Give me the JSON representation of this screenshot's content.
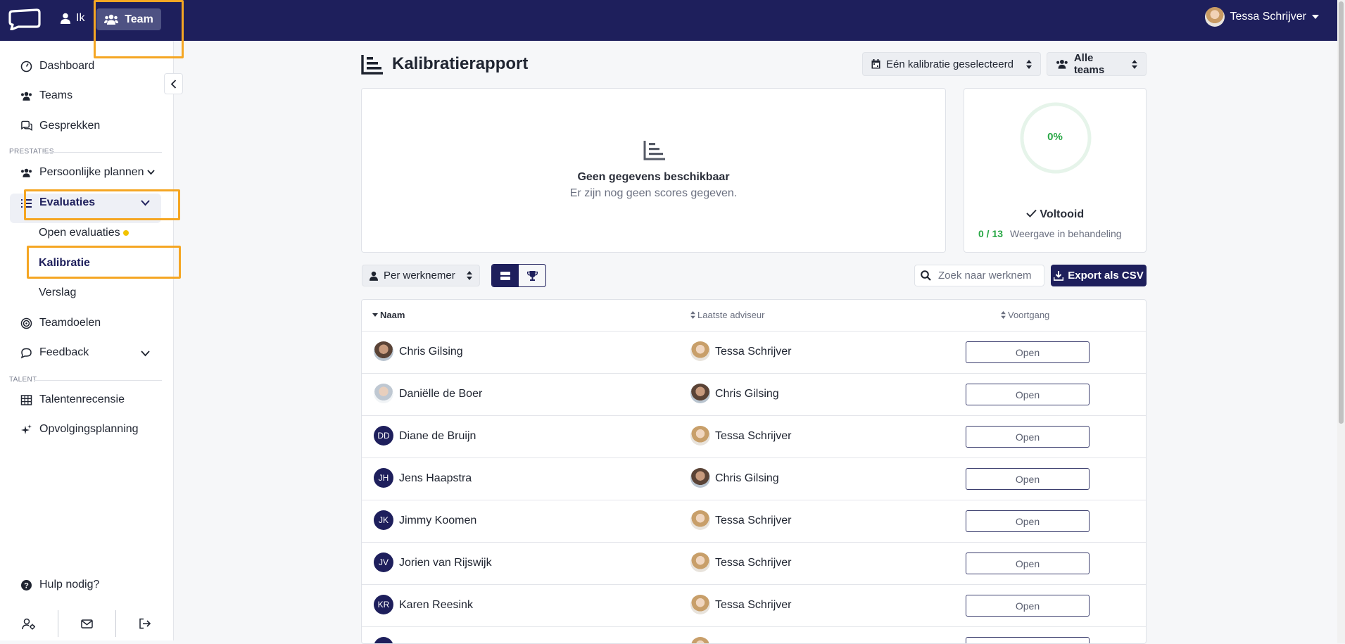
{
  "topbar": {
    "nav_ik": "Ik",
    "nav_team": "Team",
    "user_name": "Tessa Schrijver"
  },
  "sidebar": {
    "dashboard": "Dashboard",
    "teams": "Teams",
    "gesprekken": "Gesprekken",
    "section_prestaties": "PRESTATIES",
    "persoonlijke_plannen": "Persoonlijke plannen",
    "evaluaties": "Evaluaties",
    "open_evaluaties": "Open evaluaties",
    "kalibratie": "Kalibratie",
    "verslag": "Verslag",
    "teamdoelen": "Teamdoelen",
    "feedback": "Feedback",
    "section_talent": "TALENT",
    "talentenrecensie": "Talentenrecensie",
    "opvolgingsplanning": "Opvolgingsplanning",
    "help": "Hulp nodig?"
  },
  "header": {
    "title": "Kalibratierapport",
    "calibration_select": "Eén kalibratie geselecteerd",
    "teams_select": "Alle teams"
  },
  "empty_state": {
    "title": "Geen gegevens beschikbaar",
    "subtitle": "Er zijn nog geen scores gegeven."
  },
  "progress": {
    "percent_label": "0%",
    "percent_value": 0,
    "status": "Voltooid",
    "count": "0 / 13",
    "label": "Weergave in behandeling"
  },
  "toolbar": {
    "per_select": "Per werknemer",
    "search_placeholder": "Zoek naar werknem",
    "export": "Export als CSV"
  },
  "table": {
    "columns": {
      "name": "Naam",
      "advisor": "Laatste adviseur",
      "progress": "Voortgang"
    },
    "rows": [
      {
        "name": "Chris Gilsing",
        "initials": "",
        "advisor": "Tessa Schrijver",
        "status": "Open"
      },
      {
        "name": "Daniëlle de Boer",
        "initials": "",
        "advisor": "Chris Gilsing",
        "status": "Open"
      },
      {
        "name": "Diane de Bruijn",
        "initials": "DD",
        "advisor": "Tessa Schrijver",
        "status": "Open"
      },
      {
        "name": "Jens Haapstra",
        "initials": "JH",
        "advisor": "Chris Gilsing",
        "status": "Open"
      },
      {
        "name": "Jimmy Koomen",
        "initials": "JK",
        "advisor": "Tessa Schrijver",
        "status": "Open"
      },
      {
        "name": "Jorien van Rijswijk",
        "initials": "JV",
        "advisor": "Tessa Schrijver",
        "status": "Open"
      },
      {
        "name": "Karen Reesink",
        "initials": "KR",
        "advisor": "Tessa Schrijver",
        "status": "Open"
      }
    ]
  }
}
